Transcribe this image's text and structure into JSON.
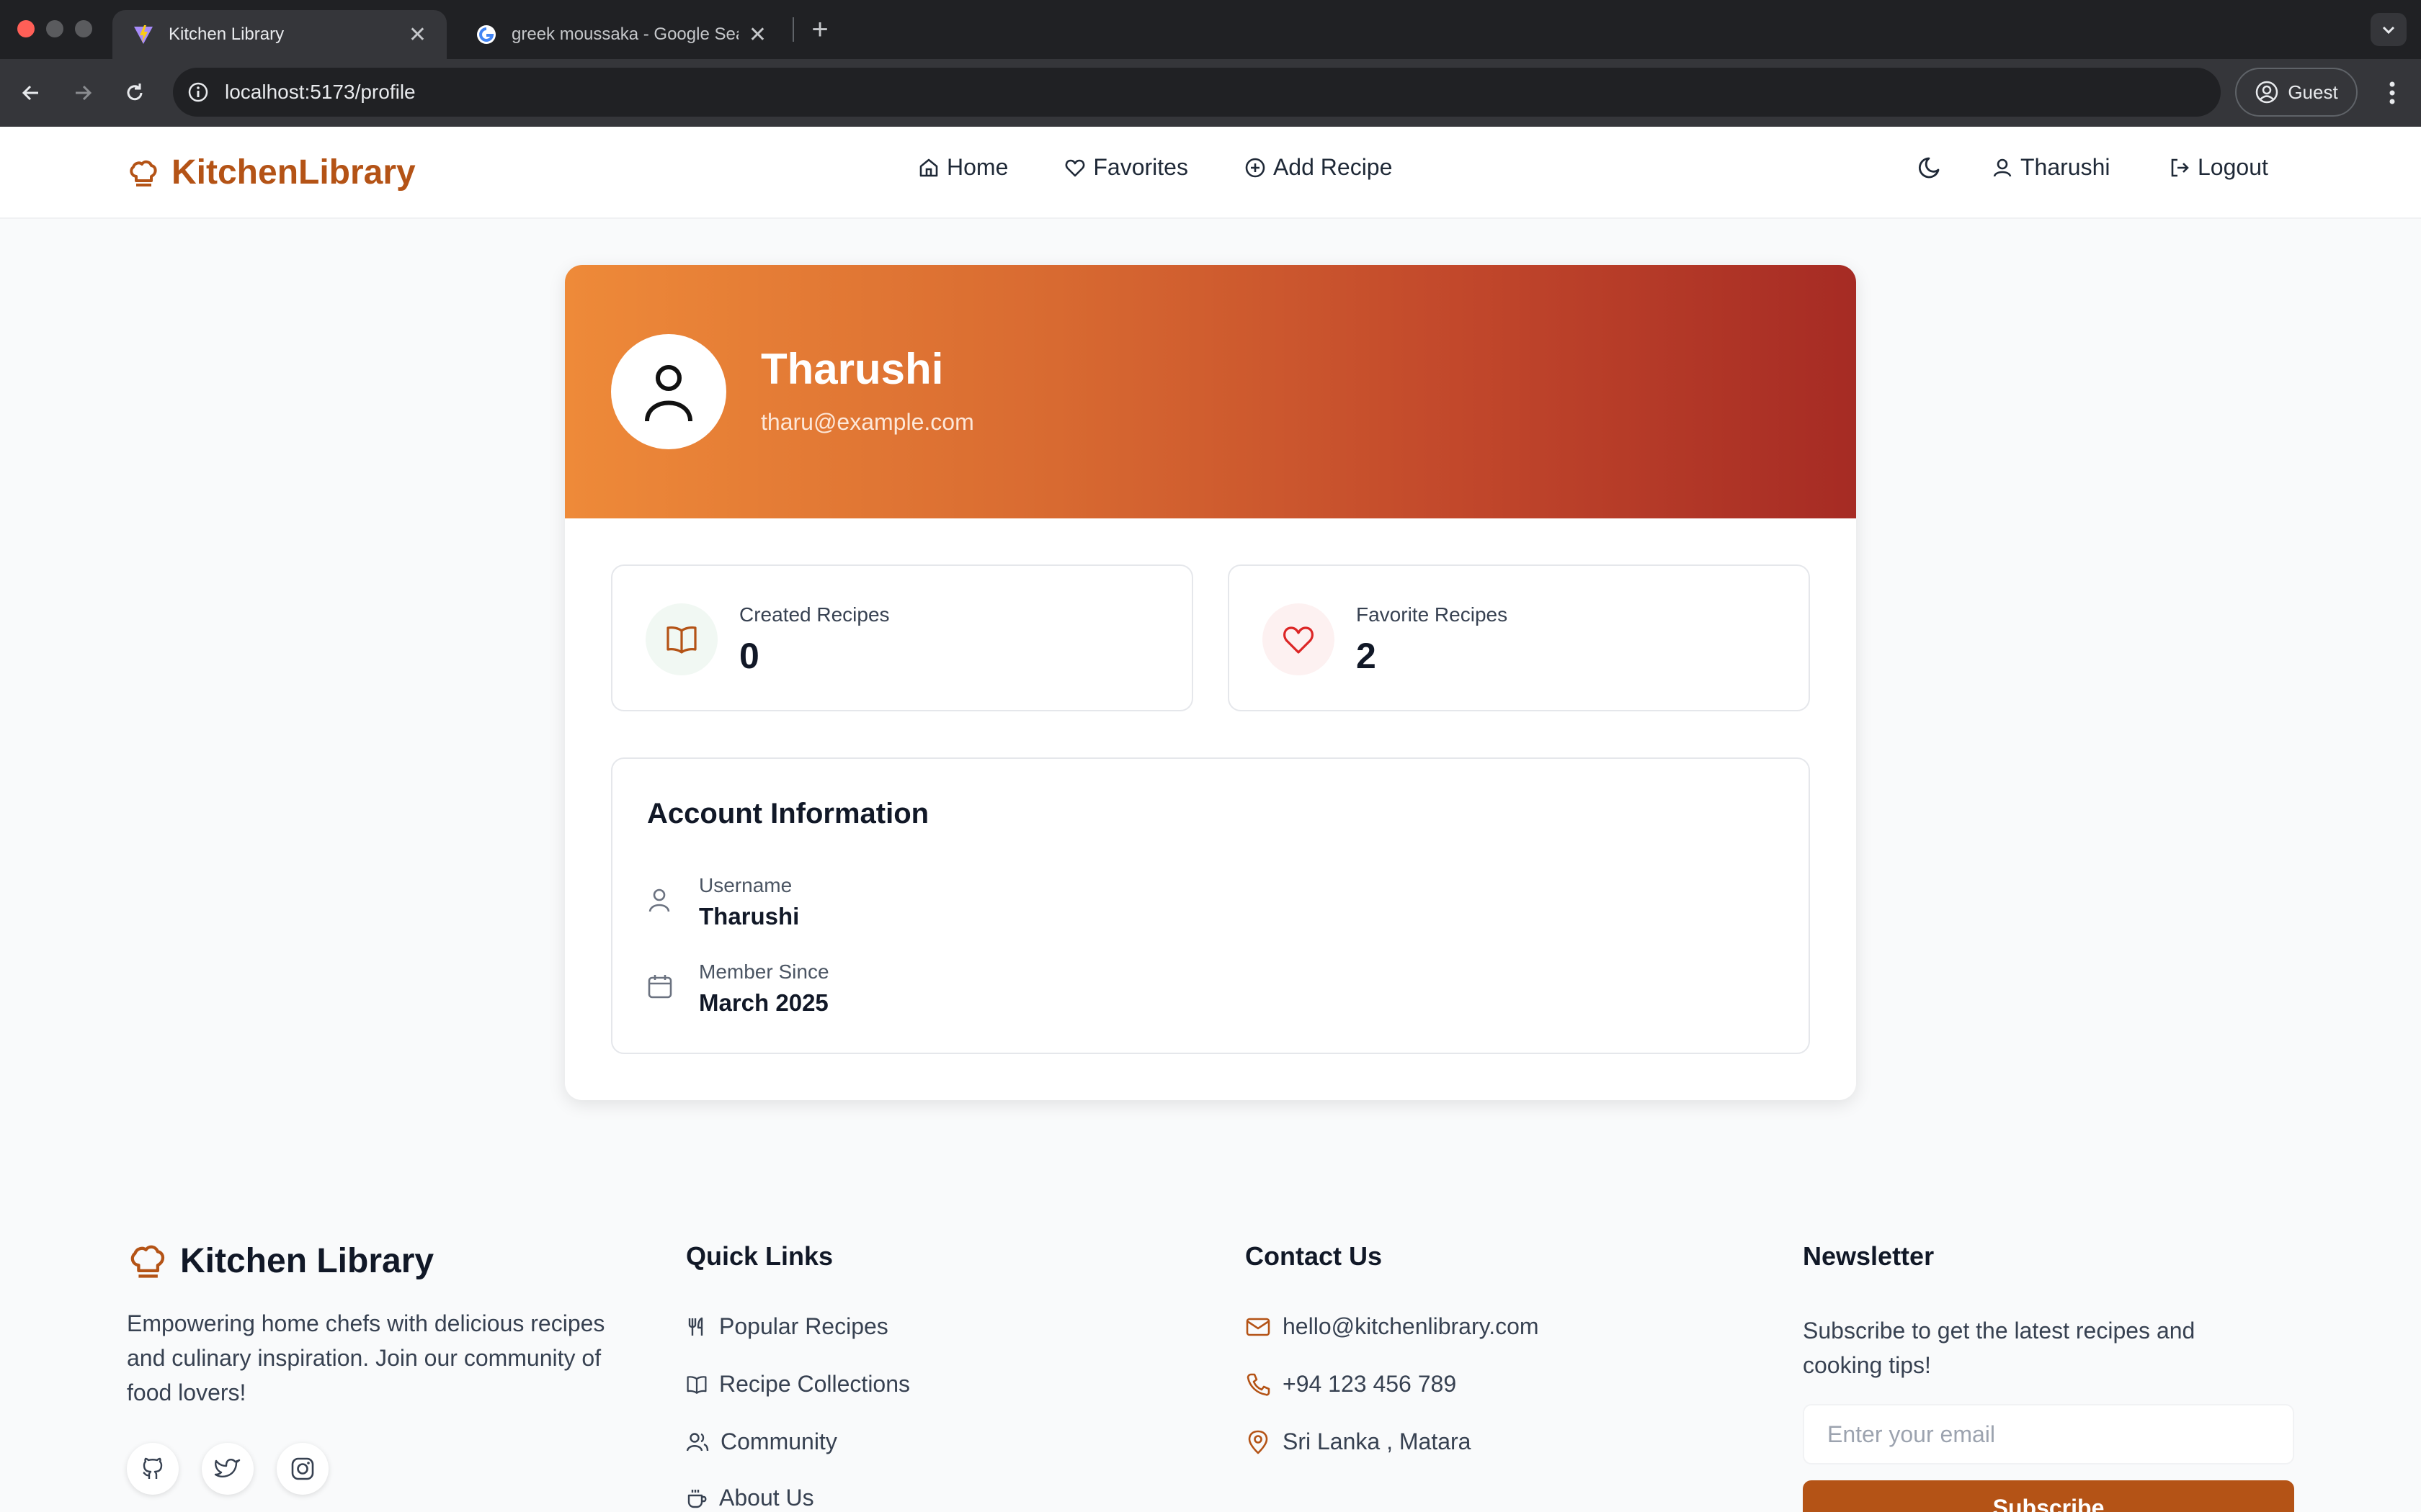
{
  "browser": {
    "tabs": [
      {
        "title": "Kitchen Library",
        "active": true
      },
      {
        "title": "greek moussaka - Google Sea",
        "active": false
      }
    ],
    "url": "localhost:5173/profile",
    "profile_label": "Guest"
  },
  "header": {
    "brand": "KitchenLibrary",
    "nav": {
      "home": "Home",
      "favorites": "Favorites",
      "add_recipe": "Add Recipe"
    },
    "user": "Tharushi",
    "logout": "Logout"
  },
  "profile": {
    "name": "Tharushi",
    "email": "tharu@example.com",
    "stats": {
      "created_label": "Created Recipes",
      "created_value": "0",
      "favorite_label": "Favorite Recipes",
      "favorite_value": "2"
    },
    "account": {
      "title": "Account Information",
      "username_label": "Username",
      "username_value": "Tharushi",
      "member_label": "Member Since",
      "member_value": "March 2025"
    }
  },
  "footer": {
    "brand": "Kitchen Library",
    "description": "Empowering home chefs with delicious recipes and culinary inspiration. Join our community of food lovers!",
    "quick_links": {
      "title": "Quick Links",
      "items": [
        "Popular Recipes",
        "Recipe Collections",
        "Community",
        "About Us"
      ]
    },
    "contact": {
      "title": "Contact Us",
      "email": "hello@kitchenlibrary.com",
      "phone": "+94 123 456 789",
      "location": "Sri Lanka , Matara"
    },
    "newsletter": {
      "title": "Newsletter",
      "description": "Subscribe to get the latest recipes and cooking tips!",
      "placeholder": "Enter your email",
      "button": "Subscribe"
    }
  },
  "colors": {
    "brand": "#b45316",
    "hero_start": "#ee8a39",
    "hero_end": "#a62b24"
  }
}
